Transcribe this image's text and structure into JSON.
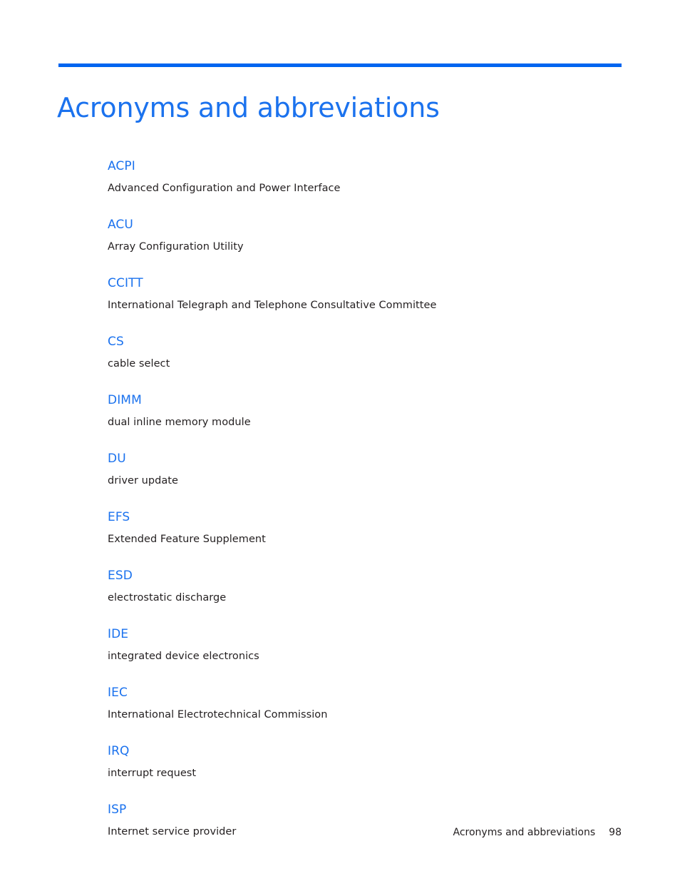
{
  "document": {
    "title": "Acronyms and abbreviations",
    "accent_color": "#1b72ee",
    "rule_color": "#0065f0",
    "body_color": "#231f20"
  },
  "glossary": {
    "entries": [
      {
        "term": "ACPI",
        "definition": "Advanced Configuration and Power Interface"
      },
      {
        "term": "ACU",
        "definition": "Array Configuration Utility"
      },
      {
        "term": "CCITT",
        "definition": "International Telegraph and Telephone Consultative Committee"
      },
      {
        "term": "CS",
        "definition": "cable select"
      },
      {
        "term": "DIMM",
        "definition": "dual inline memory module"
      },
      {
        "term": "DU",
        "definition": "driver update"
      },
      {
        "term": "EFS",
        "definition": "Extended Feature Supplement"
      },
      {
        "term": "ESD",
        "definition": "electrostatic discharge"
      },
      {
        "term": "IDE",
        "definition": "integrated device electronics"
      },
      {
        "term": "IEC",
        "definition": "International Electrotechnical Commission"
      },
      {
        "term": "IRQ",
        "definition": "interrupt request"
      },
      {
        "term": "ISP",
        "definition": "Internet service provider"
      }
    ]
  },
  "footer": {
    "label": "Acronyms and abbreviations",
    "page_number": "98"
  }
}
